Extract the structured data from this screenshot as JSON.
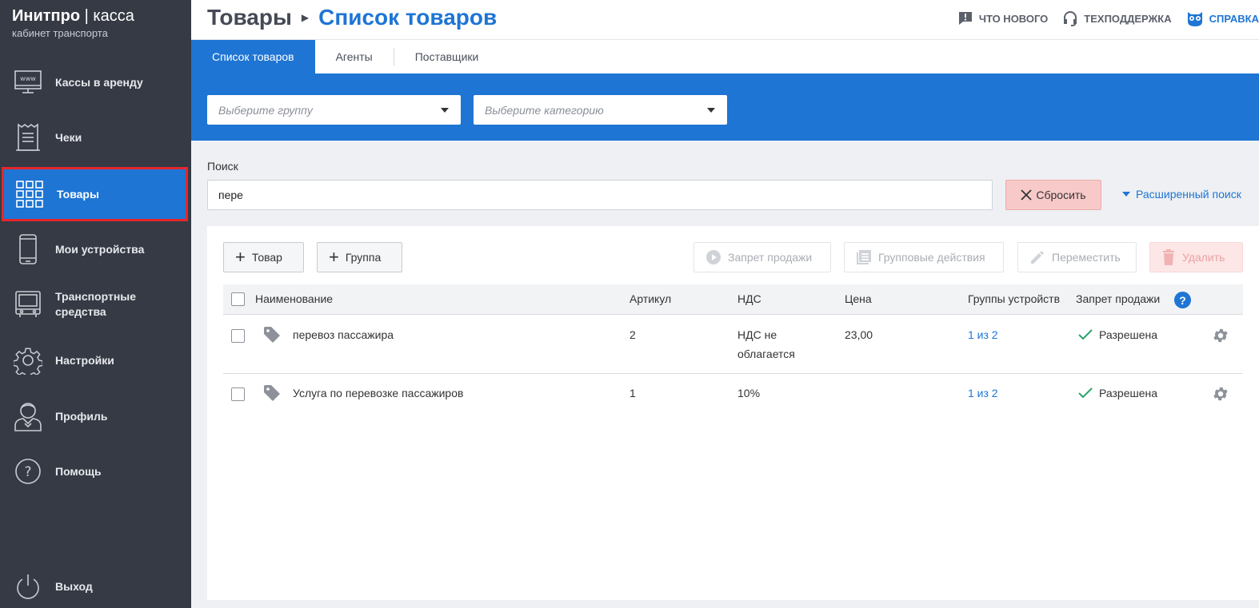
{
  "brand": {
    "name_bold": "Инитпро",
    "name_sep": " | ",
    "name_rest": "касса",
    "subtitle": "кабинет транспорта"
  },
  "sidebar": {
    "items": [
      {
        "label": "Кассы в аренду",
        "icon": "monitor-www-icon"
      },
      {
        "label": "Чеки",
        "icon": "receipt-icon"
      },
      {
        "label": "Товары",
        "icon": "grid-icon",
        "active": true
      },
      {
        "label": "Мои устройства",
        "icon": "phone-icon"
      },
      {
        "label": "Транспортные средства",
        "icon": "bus-icon"
      },
      {
        "label": "Настройки",
        "icon": "gear-icon"
      },
      {
        "label": "Профиль",
        "icon": "user-icon"
      },
      {
        "label": "Помощь",
        "icon": "question-icon"
      },
      {
        "label": "Выход",
        "icon": "power-icon"
      }
    ]
  },
  "header": {
    "crumb_parent": "Товары",
    "crumb_current": "Список товаров",
    "links": {
      "whats_new": "ЧТО НОВОГО",
      "support": "ТЕХПОДДЕРЖКА",
      "help": "СПРАВКА"
    }
  },
  "tabs": [
    "Список товаров",
    "Агенты",
    "Поставщики"
  ],
  "filters": {
    "group_placeholder": "Выберите группу",
    "category_placeholder": "Выберите категорию"
  },
  "search": {
    "label": "Поиск",
    "value": "пере",
    "reset": "Сбросить",
    "advanced": "Расширенный поиск"
  },
  "toolbar": {
    "add_product": "Товар",
    "add_group": "Группа",
    "ban_sale": "Запрет продажи",
    "group_actions": "Групповые действия",
    "move": "Переместить",
    "delete": "Удалить"
  },
  "table": {
    "columns": [
      "Наименование",
      "Артикул",
      "НДС",
      "Цена",
      "Группы устройств",
      "Запрет продажи"
    ],
    "rows": [
      {
        "name": "перевоз пассажира",
        "article": "2",
        "vat_line1": "НДС не",
        "vat_line2": "облагается",
        "price": "23,00",
        "groups": "1 из 2",
        "sale": "Разрешена"
      },
      {
        "name": "Услуга по перевозке пассажиров",
        "article": "1",
        "vat_line1": "10%",
        "vat_line2": "",
        "price": "",
        "groups": "1 из 2",
        "sale": "Разрешена"
      }
    ]
  },
  "colors": {
    "accent": "#1e75d4",
    "sidebar": "#353a45",
    "highlight": "#e5262a"
  }
}
